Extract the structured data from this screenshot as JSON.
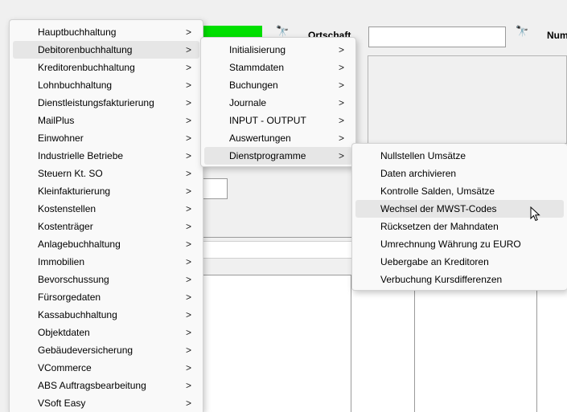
{
  "background": {
    "ortschaft_label": "Ortschaft",
    "num_label": "Num"
  },
  "menu_main": {
    "items": [
      {
        "label": "Hauptbuchhaltung",
        "arrow": ">"
      },
      {
        "label": "Debitorenbuchhaltung",
        "arrow": ">"
      },
      {
        "label": "Kreditorenbuchhaltung",
        "arrow": ">"
      },
      {
        "label": "Lohnbuchhaltung",
        "arrow": ">"
      },
      {
        "label": "Dienstleistungsfakturierung",
        "arrow": ">"
      },
      {
        "label": "MailPlus",
        "arrow": ">"
      },
      {
        "label": "Einwohner",
        "arrow": ">"
      },
      {
        "label": "Industrielle Betriebe",
        "arrow": ">"
      },
      {
        "label": "Steuern Kt. SO",
        "arrow": ">"
      },
      {
        "label": "Kleinfakturierung",
        "arrow": ">"
      },
      {
        "label": "Kostenstellen",
        "arrow": ">"
      },
      {
        "label": "Kostenträger",
        "arrow": ">"
      },
      {
        "label": "Anlagebuchhaltung",
        "arrow": ">"
      },
      {
        "label": "Immobilien",
        "arrow": ">"
      },
      {
        "label": "Bevorschussung",
        "arrow": ">"
      },
      {
        "label": "Fürsorgedaten",
        "arrow": ">"
      },
      {
        "label": "Kassabuchhaltung",
        "arrow": ">"
      },
      {
        "label": "Objektdaten",
        "arrow": ">"
      },
      {
        "label": "Gebäudeversicherung",
        "arrow": ">"
      },
      {
        "label": "VCommerce",
        "arrow": ">"
      },
      {
        "label": "ABS Auftragsbearbeitung",
        "arrow": ">"
      },
      {
        "label": "VSoft Easy",
        "arrow": ">"
      }
    ]
  },
  "menu_debitoren": {
    "items": [
      {
        "label": "Initialisierung",
        "arrow": ">"
      },
      {
        "label": "Stammdaten",
        "arrow": ">"
      },
      {
        "label": "Buchungen",
        "arrow": ">"
      },
      {
        "label": "Journale",
        "arrow": ">"
      },
      {
        "label": "INPUT - OUTPUT",
        "arrow": ">"
      },
      {
        "label": "Auswertungen",
        "arrow": ">"
      },
      {
        "label": "Dienstprogramme",
        "arrow": ">"
      }
    ]
  },
  "menu_dienstprogramme": {
    "items": [
      {
        "label": "Nullstellen Umsätze"
      },
      {
        "label": "Daten archivieren"
      },
      {
        "label": "Kontrolle Salden, Umsätze"
      },
      {
        "label": "Wechsel der MWST-Codes"
      },
      {
        "label": "Rücksetzen der Mahndaten"
      },
      {
        "label": "Umrechnung Währung zu EURO"
      },
      {
        "label": "Uebergabe an Kreditoren"
      },
      {
        "label": "Verbuchung Kursdifferenzen"
      }
    ]
  },
  "icons": {
    "search": "binoculars-icon",
    "cursor": "mouse-pointer-icon"
  }
}
